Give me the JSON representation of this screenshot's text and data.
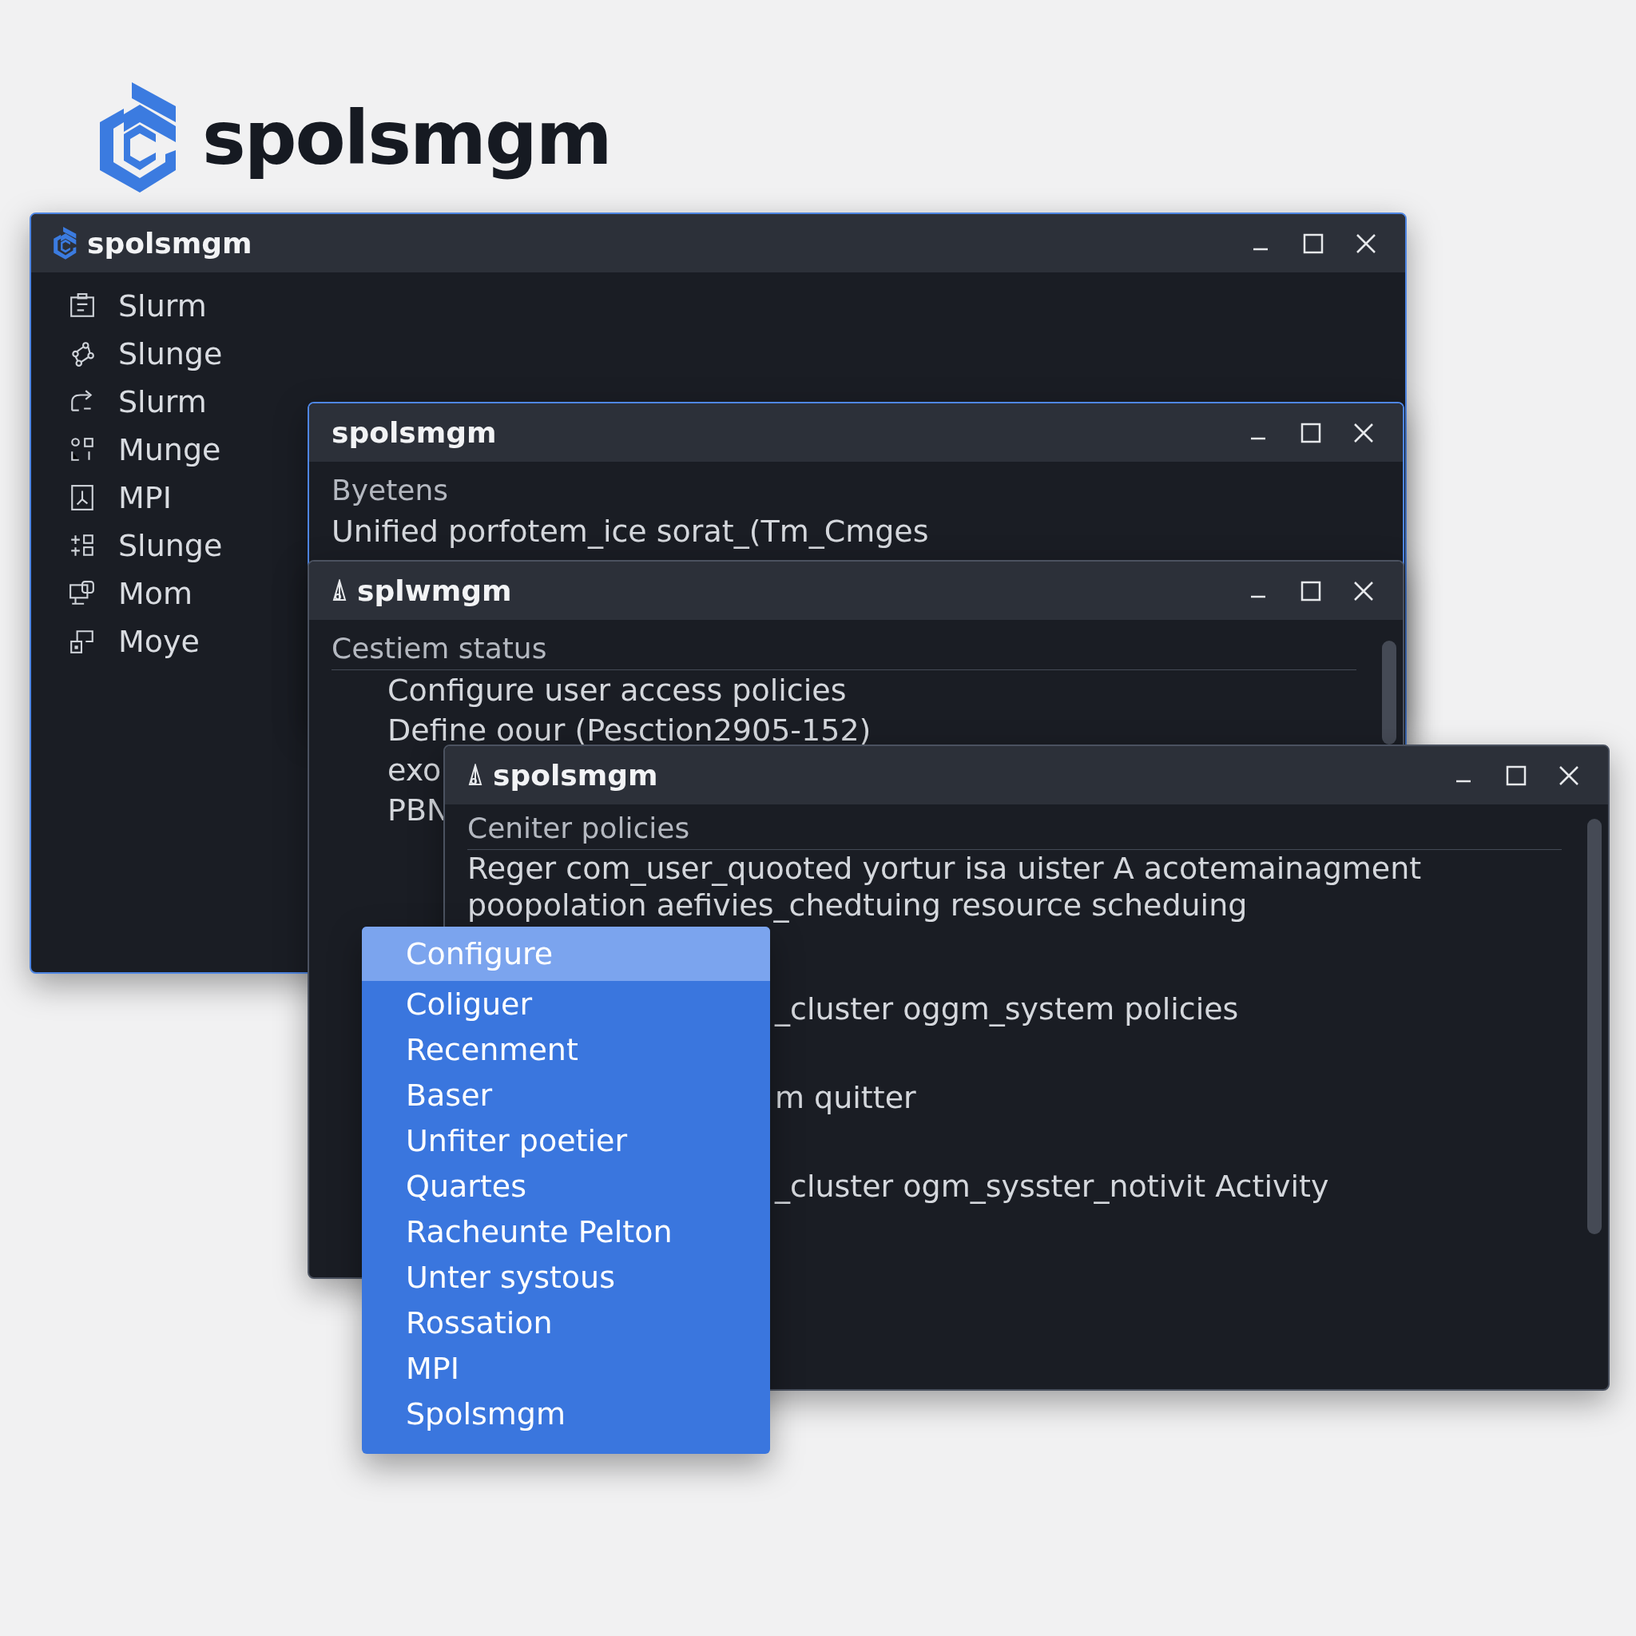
{
  "logo": {
    "text": "spolsmgm"
  },
  "main_window": {
    "title": "spolsmgm",
    "focused": true,
    "sidebar": {
      "items": [
        {
          "label": "Slurm"
        },
        {
          "label": "Slunge"
        },
        {
          "label": "Slurm"
        },
        {
          "label": "Munge"
        },
        {
          "label": "MPI"
        },
        {
          "label": "Slunge"
        },
        {
          "label": "Mom"
        },
        {
          "label": "Moye"
        }
      ]
    }
  },
  "info_window": {
    "title": "spolsmgm",
    "focused": true,
    "heading": "Byetens",
    "text": "Unified porfotem_ice sorat_(Tm_Cmges"
  },
  "status_window": {
    "title": "splᴡmgm",
    "focused": false,
    "heading": "Cestiem status",
    "lines": [
      "Configure user access policies",
      "Define oour (Pesction2905-152)",
      "exo",
      "PBN"
    ]
  },
  "policies_window": {
    "title": "spolsmgm",
    "focused": false,
    "heading": "Ceniter policies",
    "lines": [
      "Reger com_user_quooted yortur isa  uister  A acotemainagment",
      "poopolation aefivies_chedtuing resource scheduing"
    ],
    "detail_lines": [
      "_cluster oggm_system policies",
      "m quitter",
      "_cluster ogm_sysster_notivit Activity"
    ]
  },
  "context_menu": {
    "items": [
      {
        "label": "Configure",
        "selected": true
      },
      {
        "label": "Coliguer",
        "selected": false
      },
      {
        "label": "Recenment",
        "selected": false
      },
      {
        "label": "Baser",
        "selected": false
      },
      {
        "label": "Unfiter poetier",
        "selected": false
      },
      {
        "label": "Quartes",
        "selected": false
      },
      {
        "label": "Racheunte Pelton",
        "selected": false
      },
      {
        "label": "Unter systous",
        "selected": false
      },
      {
        "label": "Rossation",
        "selected": false
      },
      {
        "label": "MPI",
        "selected": false
      },
      {
        "label": "Spolsmgm",
        "selected": false
      }
    ]
  }
}
